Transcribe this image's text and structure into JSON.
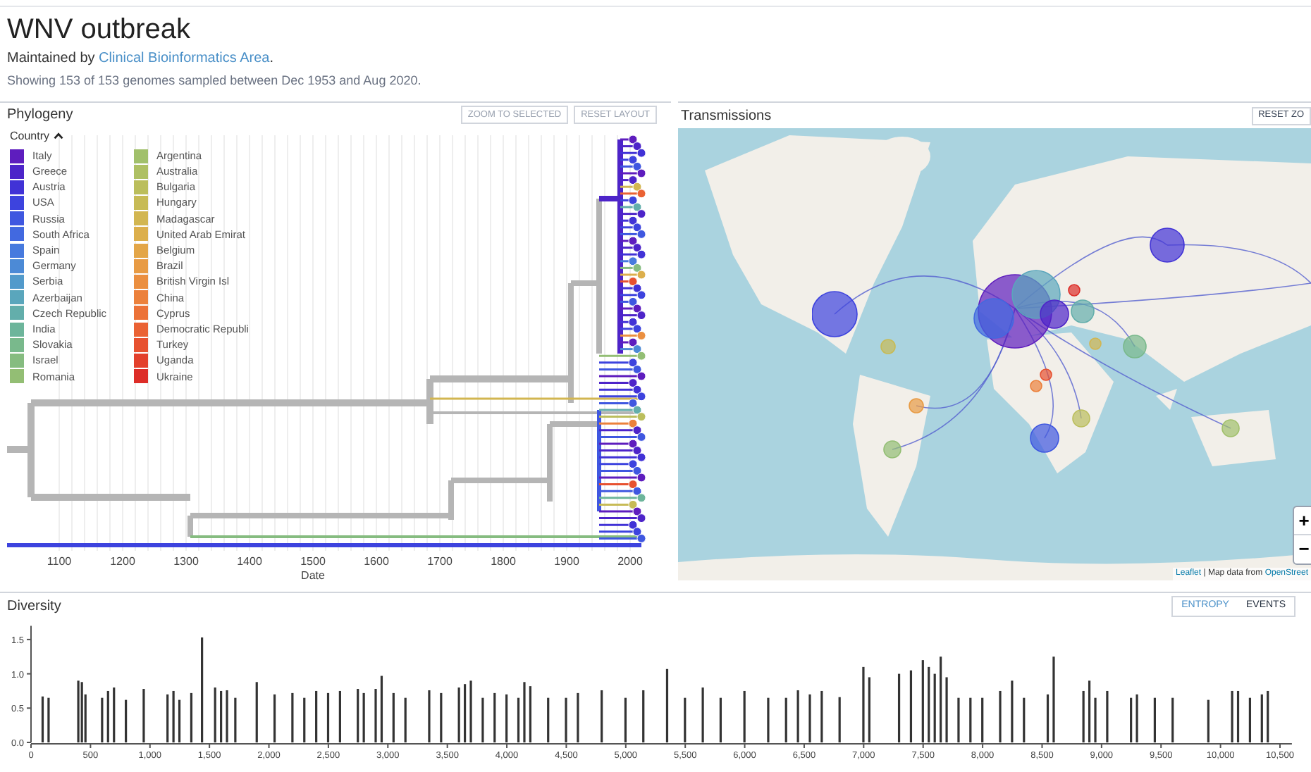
{
  "header": {
    "title": "WNV outbreak",
    "maintainer_prefix": "Maintained by ",
    "maintainer_link": "Clinical Bioinformatics Area",
    "maintainer_suffix": ".",
    "summary": "Showing 153 of 153 genomes sampled between Dec 1953 and Aug 2020."
  },
  "phylogeny": {
    "title": "Phylogeny",
    "buttons": [
      {
        "label": "ZOOM TO SELECTED",
        "disabled": true
      },
      {
        "label": "RESET LAYOUT",
        "disabled": true
      }
    ],
    "legend": {
      "title": "Country",
      "expanded": true,
      "items": [
        {
          "label": "Italy",
          "color": "#5e1dbe"
        },
        {
          "label": "Greece",
          "color": "#4d24c9"
        },
        {
          "label": "Austria",
          "color": "#4132d6"
        },
        {
          "label": "USA",
          "color": "#3d43de"
        },
        {
          "label": "Russia",
          "color": "#3f57e0"
        },
        {
          "label": "South Africa",
          "color": "#4269e0"
        },
        {
          "label": "Spain",
          "color": "#477ade"
        },
        {
          "label": "Germany",
          "color": "#4c8ad6"
        },
        {
          "label": "Serbia",
          "color": "#529acb"
        },
        {
          "label": "Azerbaijan",
          "color": "#5aa6bc"
        },
        {
          "label": "Czech Republic",
          "color": "#63aeab"
        },
        {
          "label": "India",
          "color": "#6db59b"
        },
        {
          "label": "Slovakia",
          "color": "#79b98c"
        },
        {
          "label": "Israel",
          "color": "#86bc80"
        },
        {
          "label": "Romania",
          "color": "#93be74"
        },
        {
          "label": "Argentina",
          "color": "#a1c06b"
        },
        {
          "label": "Australia",
          "color": "#aec063"
        },
        {
          "label": "Bulgaria",
          "color": "#bbbe5c"
        },
        {
          "label": "Hungary",
          "color": "#c7bb56"
        },
        {
          "label": "Madagascar",
          "color": "#d2b651"
        },
        {
          "label": "United Arab Emirat",
          "color": "#dcaf4c"
        },
        {
          "label": "Belgium",
          "color": "#e3a648"
        },
        {
          "label": "Brazil",
          "color": "#e89b44"
        },
        {
          "label": "British Virgin Isl",
          "color": "#eb8f40"
        },
        {
          "label": "China",
          "color": "#ec813c"
        },
        {
          "label": "Cyprus",
          "color": "#ec7238"
        },
        {
          "label": "Democratic Republi",
          "color": "#ea6234"
        },
        {
          "label": "Turkey",
          "color": "#e75130"
        },
        {
          "label": "Uganda",
          "color": "#e3402c"
        },
        {
          "label": "Ukraine",
          "color": "#dd2d28"
        }
      ]
    },
    "axis": {
      "label": "Date",
      "ticks": [
        "1100",
        "1200",
        "1300",
        "1400",
        "1500",
        "1600",
        "1700",
        "1800",
        "1900",
        "2000"
      ]
    }
  },
  "transmissions": {
    "title": "Transmissions",
    "buttons": [
      {
        "label": "RESET ZO"
      }
    ],
    "zoom_controls": [
      "+",
      "−"
    ],
    "attribution": {
      "link_1": "Leaflet",
      "text": " | Map data from ",
      "link_2": "OpenStreet"
    }
  },
  "diversity": {
    "title": "Diversity",
    "tabs": [
      {
        "label": "ENTROPY",
        "selected": true
      },
      {
        "label": "EVENTS",
        "selected": false
      }
    ],
    "chart_data": {
      "type": "bar",
      "xlim": [
        0,
        10600
      ],
      "ylim": [
        0,
        1.7
      ],
      "yticks": [
        {
          "value": 0,
          "label": "0.0"
        },
        {
          "value": 0.5,
          "label": "0.5"
        },
        {
          "value": 1,
          "label": "1.0"
        },
        {
          "value": 1.5,
          "label": "1.5"
        }
      ],
      "xticks": [
        {
          "value": 0,
          "label": "0"
        },
        {
          "value": 500,
          "label": "500"
        },
        {
          "value": 1000,
          "label": "1,000"
        },
        {
          "value": 1500,
          "label": "1,500"
        },
        {
          "value": 2000,
          "label": "2,000"
        },
        {
          "value": 2500,
          "label": "2,500"
        },
        {
          "value": 3000,
          "label": "3,000"
        },
        {
          "value": 3500,
          "label": "3,500"
        },
        {
          "value": 4000,
          "label": "4,000"
        },
        {
          "value": 4500,
          "label": "4,500"
        },
        {
          "value": 5000,
          "label": "5,000"
        },
        {
          "value": 5500,
          "label": "5,500"
        },
        {
          "value": 6000,
          "label": "6,000"
        },
        {
          "value": 6500,
          "label": "6,500"
        },
        {
          "value": 7000,
          "label": "7,000"
        },
        {
          "value": 7500,
          "label": "7,500"
        },
        {
          "value": 8000,
          "label": "8,000"
        },
        {
          "value": 8500,
          "label": "8,500"
        },
        {
          "value": 9000,
          "label": "9,000"
        },
        {
          "value": 9500,
          "label": "9,500"
        },
        {
          "value": 10000,
          "label": "10,000"
        },
        {
          "value": 10500,
          "label": "10,500"
        }
      ],
      "x": [
        100,
        150,
        400,
        430,
        460,
        600,
        650,
        700,
        800,
        950,
        1150,
        1200,
        1250,
        1350,
        1440,
        1550,
        1600,
        1650,
        1720,
        1900,
        2050,
        2200,
        2300,
        2400,
        2500,
        2600,
        2750,
        2800,
        2900,
        2950,
        3050,
        3150,
        3350,
        3450,
        3600,
        3650,
        3700,
        3800,
        3900,
        4000,
        4100,
        4150,
        4200,
        4350,
        4500,
        4600,
        4800,
        5000,
        5150,
        5350,
        5500,
        5650,
        5800,
        6000,
        6200,
        6350,
        6450,
        6550,
        6650,
        6800,
        7000,
        7050,
        7300,
        7400,
        7500,
        7550,
        7600,
        7650,
        7700,
        7800,
        7900,
        8000,
        8150,
        8250,
        8350,
        8550,
        8600,
        8850,
        8900,
        8950,
        9050,
        9250,
        9300,
        9450,
        9600,
        9900,
        10100,
        10150,
        10250,
        10350,
        10400
      ],
      "series": [
        {
          "color": "#333333",
          "values": [
            0.67,
            0.65,
            0.9,
            0.88,
            0.7,
            0.65,
            0.75,
            0.8,
            0.62,
            0.78,
            0.7,
            0.75,
            0.62,
            0.72,
            1.53,
            0.8,
            0.75,
            0.76,
            0.65,
            0.88,
            0.7,
            0.72,
            0.65,
            0.75,
            0.72,
            0.75,
            0.78,
            0.72,
            0.78,
            0.97,
            0.72,
            0.65,
            0.76,
            0.72,
            0.8,
            0.85,
            0.9,
            0.65,
            0.72,
            0.7,
            0.65,
            0.88,
            0.82,
            0.65,
            0.65,
            0.72,
            0.76,
            0.65,
            0.76,
            1.07,
            0.65,
            0.8,
            0.65,
            0.75,
            0.65,
            0.65,
            0.76,
            0.7,
            0.75,
            0.66,
            1.1,
            0.95,
            1.0,
            1.05,
            1.2,
            1.1,
            1.0,
            1.25,
            0.95,
            0.65,
            0.65,
            0.65,
            0.75,
            0.9,
            0.65,
            0.7,
            1.25,
            0.75,
            0.9,
            0.65,
            0.75,
            0.65,
            0.7,
            0.65,
            0.65,
            0.62,
            0.75,
            0.75,
            0.65,
            0.7,
            0.75
          ]
        }
      ]
    }
  }
}
